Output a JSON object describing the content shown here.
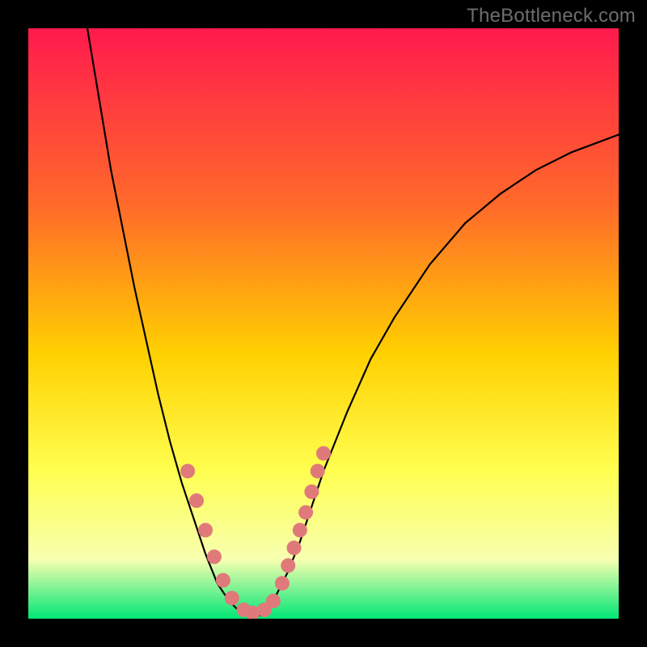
{
  "watermark": "TheBottleneck.com",
  "colors": {
    "top": "#ff1a4d",
    "mid1": "#ff6a2a",
    "mid2": "#ffd000",
    "mid3": "#ffff50",
    "mid4": "#f7ffb0",
    "bottom": "#00e676",
    "curve": "#000000",
    "dots": "#e07a7a",
    "bg": "#000000"
  },
  "chart_data": {
    "type": "line",
    "title": "",
    "xlabel": "",
    "ylabel": "",
    "xlim": [
      0,
      100
    ],
    "ylim": [
      0,
      100
    ],
    "grid": false,
    "curve_left": [
      {
        "x": 10,
        "y": 100
      },
      {
        "x": 12,
        "y": 88
      },
      {
        "x": 14,
        "y": 76
      },
      {
        "x": 16,
        "y": 66
      },
      {
        "x": 18,
        "y": 56
      },
      {
        "x": 20,
        "y": 47
      },
      {
        "x": 22,
        "y": 38
      },
      {
        "x": 24,
        "y": 30
      },
      {
        "x": 26,
        "y": 23
      },
      {
        "x": 28,
        "y": 17
      },
      {
        "x": 30,
        "y": 11
      },
      {
        "x": 32,
        "y": 6
      },
      {
        "x": 34,
        "y": 3
      },
      {
        "x": 36,
        "y": 1
      },
      {
        "x": 38,
        "y": 0
      }
    ],
    "curve_right": [
      {
        "x": 38,
        "y": 0
      },
      {
        "x": 40,
        "y": 1
      },
      {
        "x": 42,
        "y": 4
      },
      {
        "x": 44,
        "y": 8
      },
      {
        "x": 46,
        "y": 13
      },
      {
        "x": 48,
        "y": 19
      },
      {
        "x": 50,
        "y": 25
      },
      {
        "x": 54,
        "y": 35
      },
      {
        "x": 58,
        "y": 44
      },
      {
        "x": 62,
        "y": 51
      },
      {
        "x": 68,
        "y": 60
      },
      {
        "x": 74,
        "y": 67
      },
      {
        "x": 80,
        "y": 72
      },
      {
        "x": 86,
        "y": 76
      },
      {
        "x": 92,
        "y": 79
      },
      {
        "x": 100,
        "y": 82
      }
    ],
    "dots": [
      {
        "x": 27.0,
        "y": 25.0
      },
      {
        "x": 28.5,
        "y": 20.0
      },
      {
        "x": 30.0,
        "y": 15.0
      },
      {
        "x": 31.5,
        "y": 10.5
      },
      {
        "x": 33.0,
        "y": 6.5
      },
      {
        "x": 34.5,
        "y": 3.5
      },
      {
        "x": 36.5,
        "y": 1.5
      },
      {
        "x": 38.0,
        "y": 1.0
      },
      {
        "x": 40.0,
        "y": 1.5
      },
      {
        "x": 41.5,
        "y": 3.0
      },
      {
        "x": 43.0,
        "y": 6.0
      },
      {
        "x": 44.0,
        "y": 9.0
      },
      {
        "x": 45.0,
        "y": 12.0
      },
      {
        "x": 46.0,
        "y": 15.0
      },
      {
        "x": 47.0,
        "y": 18.0
      },
      {
        "x": 48.0,
        "y": 21.5
      },
      {
        "x": 49.0,
        "y": 25.0
      },
      {
        "x": 50.0,
        "y": 28.0
      }
    ]
  }
}
